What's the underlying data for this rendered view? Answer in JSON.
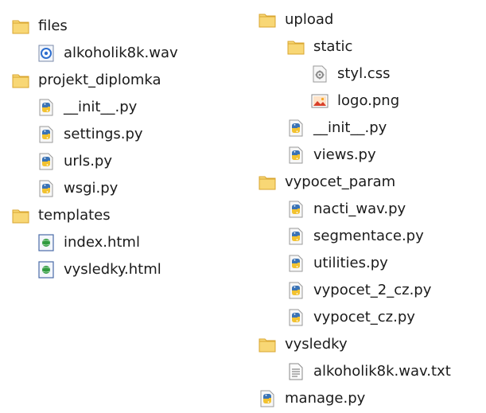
{
  "left": [
    {
      "label": "files",
      "icon": "folder-icon",
      "depth": 0
    },
    {
      "label": "alkoholik8k.wav",
      "icon": "audio-file-icon",
      "depth": 1
    },
    {
      "label": "projekt_diplomka",
      "icon": "folder-icon",
      "depth": 0
    },
    {
      "label": "__init__.py",
      "icon": "python-file-icon",
      "depth": 1
    },
    {
      "label": "settings.py",
      "icon": "python-file-icon",
      "depth": 1
    },
    {
      "label": "urls.py",
      "icon": "python-file-icon",
      "depth": 1
    },
    {
      "label": "wsgi.py",
      "icon": "python-file-icon",
      "depth": 1
    },
    {
      "label": "templates",
      "icon": "folder-icon",
      "depth": 0
    },
    {
      "label": "index.html",
      "icon": "html-file-icon",
      "depth": 1
    },
    {
      "label": "vysledky.html",
      "icon": "html-file-icon",
      "depth": 1
    }
  ],
  "right": [
    {
      "label": "upload",
      "icon": "folder-icon",
      "depth": 0
    },
    {
      "label": "static",
      "icon": "folder-icon",
      "depth": 1
    },
    {
      "label": "styl.css",
      "icon": "css-file-icon",
      "depth": 2
    },
    {
      "label": "logo.png",
      "icon": "image-file-icon",
      "depth": 2
    },
    {
      "label": "__init__.py",
      "icon": "python-file-icon",
      "depth": 1
    },
    {
      "label": "views.py",
      "icon": "python-file-icon",
      "depth": 1
    },
    {
      "label": "vypocet_param",
      "icon": "folder-icon",
      "depth": 0
    },
    {
      "label": "nacti_wav.py",
      "icon": "python-file-icon",
      "depth": 1
    },
    {
      "label": "segmentace.py",
      "icon": "python-file-icon",
      "depth": 1
    },
    {
      "label": "utilities.py",
      "icon": "python-file-icon",
      "depth": 1
    },
    {
      "label": "vypocet_2_cz.py",
      "icon": "python-file-icon",
      "depth": 1
    },
    {
      "label": "vypocet_cz.py",
      "icon": "python-file-icon",
      "depth": 1
    },
    {
      "label": "vysledky",
      "icon": "folder-icon",
      "depth": 0
    },
    {
      "label": "alkoholik8k.wav.txt",
      "icon": "text-file-icon",
      "depth": 1
    },
    {
      "label": "manage.py",
      "icon": "python-file-icon",
      "depth": 0
    }
  ],
  "colors": {
    "folder_fill": "#f8d775",
    "folder_edge": "#d9a630",
    "python_blue": "#3a73b5",
    "python_yellow": "#f2c230",
    "html_globe": "#2f9a3e",
    "audio_blue": "#2e6fcf",
    "image_red": "#d8402a"
  }
}
